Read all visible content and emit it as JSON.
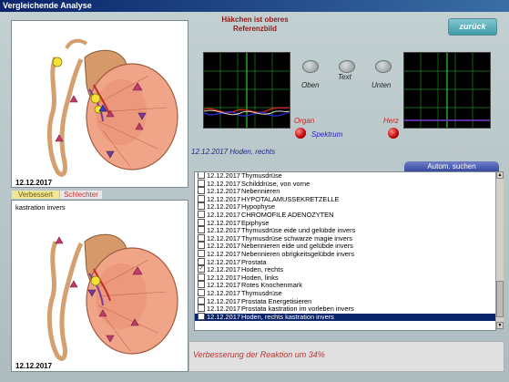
{
  "window": {
    "title": "Vergleichende Analyse"
  },
  "hint": {
    "line1": "Häkchen ist oberes",
    "line2": "Referenzbild"
  },
  "back_button": "zurück",
  "scope_controls": {
    "oben": "Oben",
    "text": "Text",
    "unten": "Unten",
    "organ": "Organ",
    "herz": "Herz",
    "spektrum": "Spektrum"
  },
  "top_panel": {
    "date": "12.12.2017"
  },
  "tabs": {
    "verbessert": "Verbessert",
    "schlechter": "Schlechter"
  },
  "bottom_panel": {
    "caption": "kastration invers",
    "date": "12.12.2017"
  },
  "selected_label": "12.12.2017  Hoden, rechts",
  "autom_suchen": "Autom. suchen",
  "list": [
    {
      "date": "12.12.2017",
      "name": "Thymusdrüse",
      "checked": false,
      "selected": false
    },
    {
      "date": "12.12.2017",
      "name": "Schilddrüse, von vorne",
      "checked": false,
      "selected": false
    },
    {
      "date": "12.12.2017",
      "name": "Nebennieren",
      "checked": false,
      "selected": false
    },
    {
      "date": "12.12.2017",
      "name": "HYPOTALAMUSSEKRETZELLE",
      "checked": false,
      "selected": false
    },
    {
      "date": "12.12.2017",
      "name": "Hypophyse",
      "checked": false,
      "selected": false
    },
    {
      "date": "12.12.2017",
      "name": "CHROMOFILE ADENOZYTEN",
      "checked": false,
      "selected": false
    },
    {
      "date": "12.12.2017",
      "name": "Epiphyse",
      "checked": false,
      "selected": false
    },
    {
      "date": "12.12.2017",
      "name": "Thymusdrüse  eide und gelübde invers",
      "checked": false,
      "selected": false
    },
    {
      "date": "12.12.2017",
      "name": "Thymusdrüse  schwarze magie invers",
      "checked": false,
      "selected": false
    },
    {
      "date": "12.12.2017",
      "name": "Nebennieren  eide und gelübde invers",
      "checked": false,
      "selected": false
    },
    {
      "date": "12.12.2017",
      "name": "Nebennieren  obrigkeitsgelübde invers",
      "checked": false,
      "selected": false
    },
    {
      "date": "12.12.2017",
      "name": "Prostata",
      "checked": false,
      "selected": false
    },
    {
      "date": "12.12.2017",
      "name": "Hoden, rechts",
      "checked": true,
      "selected": false
    },
    {
      "date": "12.12.2017",
      "name": "Hoden, links",
      "checked": false,
      "selected": false
    },
    {
      "date": "12.12.2017",
      "name": "Rotes Knochenmark",
      "checked": false,
      "selected": false
    },
    {
      "date": "12.12.2017",
      "name": "Thymusdrüse",
      "checked": false,
      "selected": false
    },
    {
      "date": "12.12.2017",
      "name": "Prostata  Energetisieren",
      "checked": false,
      "selected": false
    },
    {
      "date": "12.12.2017",
      "name": "Prostata  kastration im vorleben invers",
      "checked": false,
      "selected": false
    },
    {
      "date": "12.12.2017",
      "name": "Hoden, rechts  kastration invers",
      "checked": false,
      "selected": true
    }
  ],
  "result": "Verbesserung der Reaktion um 34%",
  "colors": {
    "accent_red": "#c03030",
    "list_selection": "#0a246a",
    "scope_grid": "#1e8a1e"
  }
}
